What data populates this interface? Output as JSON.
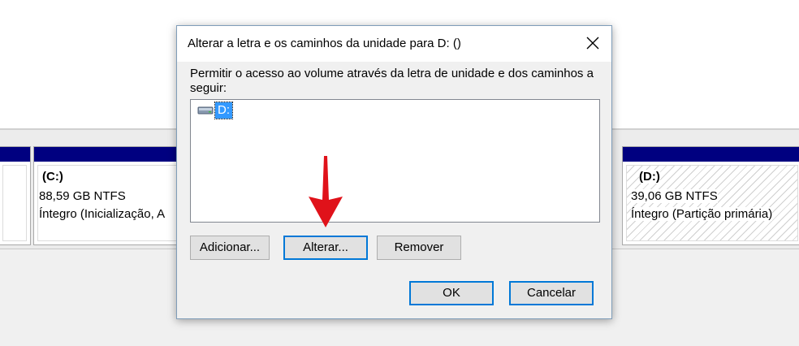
{
  "dialog": {
    "title": "Alterar a letra e os caminhos da unidade para D: ()",
    "description": "Permitir o acesso ao volume através da letra de unidade e dos caminhos a seguir:",
    "list_items": [
      {
        "label": "D:",
        "icon": "drive-icon",
        "selected": true
      }
    ],
    "buttons": {
      "add": "Adicionar...",
      "change": "Alterar...",
      "remove": "Remover",
      "ok": "OK",
      "cancel": "Cancelar"
    },
    "close_icon": "close-icon"
  },
  "partitions": {
    "c": {
      "name": "(C:)",
      "size": "88,59 GB NTFS",
      "status": "Íntegro (Inicialização, A"
    },
    "d": {
      "name": "(D:)",
      "size": "39,06 GB NTFS",
      "status": "Íntegro (Partição primária)"
    }
  },
  "colors": {
    "partition_bar": "#000080",
    "selection": "#3399ff",
    "focus_border": "#0078d7",
    "arrow": "#e0121a"
  },
  "annotation": {
    "icon": "red-arrow-icon"
  }
}
